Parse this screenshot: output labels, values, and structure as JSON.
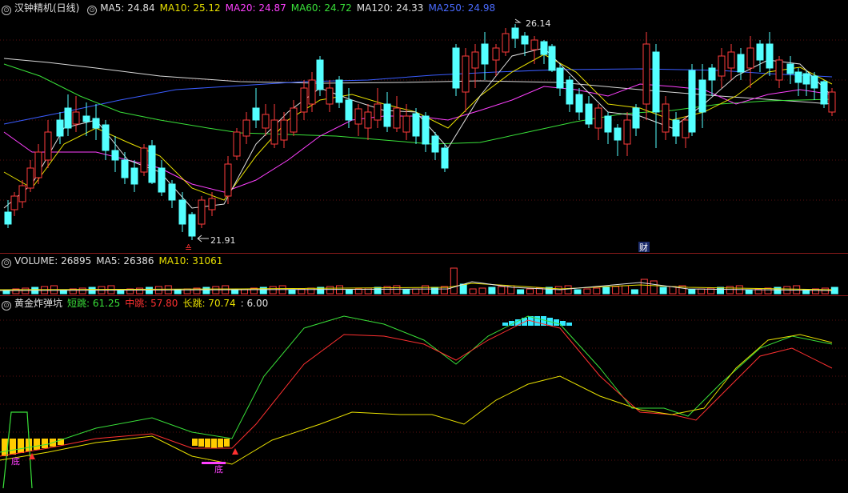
{
  "main": {
    "title": "汉钟精机(日线)",
    "ma": [
      {
        "label": "MA5: 24.84",
        "color": "#e0e0e0"
      },
      {
        "label": "MA10: 25.12",
        "color": "#e8e000"
      },
      {
        "label": "MA20: 24.87",
        "color": "#ff40ff"
      },
      {
        "label": "MA60: 24.72",
        "color": "#39e039"
      },
      {
        "label": "MA120: 24.33",
        "color": "#e0e0e0"
      },
      {
        "label": "MA250: 24.98",
        "color": "#4a6bff"
      }
    ],
    "high_label": "26.14",
    "low_label": "21.91",
    "marker_cai": "财",
    "marker_bottom": "≙"
  },
  "volume": {
    "title": "VOLUME: 26895",
    "ma5": "MA5: 26386",
    "ma10": "MA10: 31061"
  },
  "indicator": {
    "title": "黄金炸弹坑",
    "short": "短跳: 61.25",
    "mid": "中跳: 57.80",
    "long": "长跳: 70.74",
    "extra": ": 6.00",
    "bottom_label": "底"
  },
  "colors": {
    "up": "#ff3b3b",
    "down": "#54ffff",
    "ma5": "#e0e0e0",
    "ma10": "#e8e000",
    "ma20": "#ff40ff",
    "ma60": "#39e039",
    "ma120": "#d8d8d8",
    "ma250": "#3a5cff",
    "divider": "#8a1a1a"
  }
}
